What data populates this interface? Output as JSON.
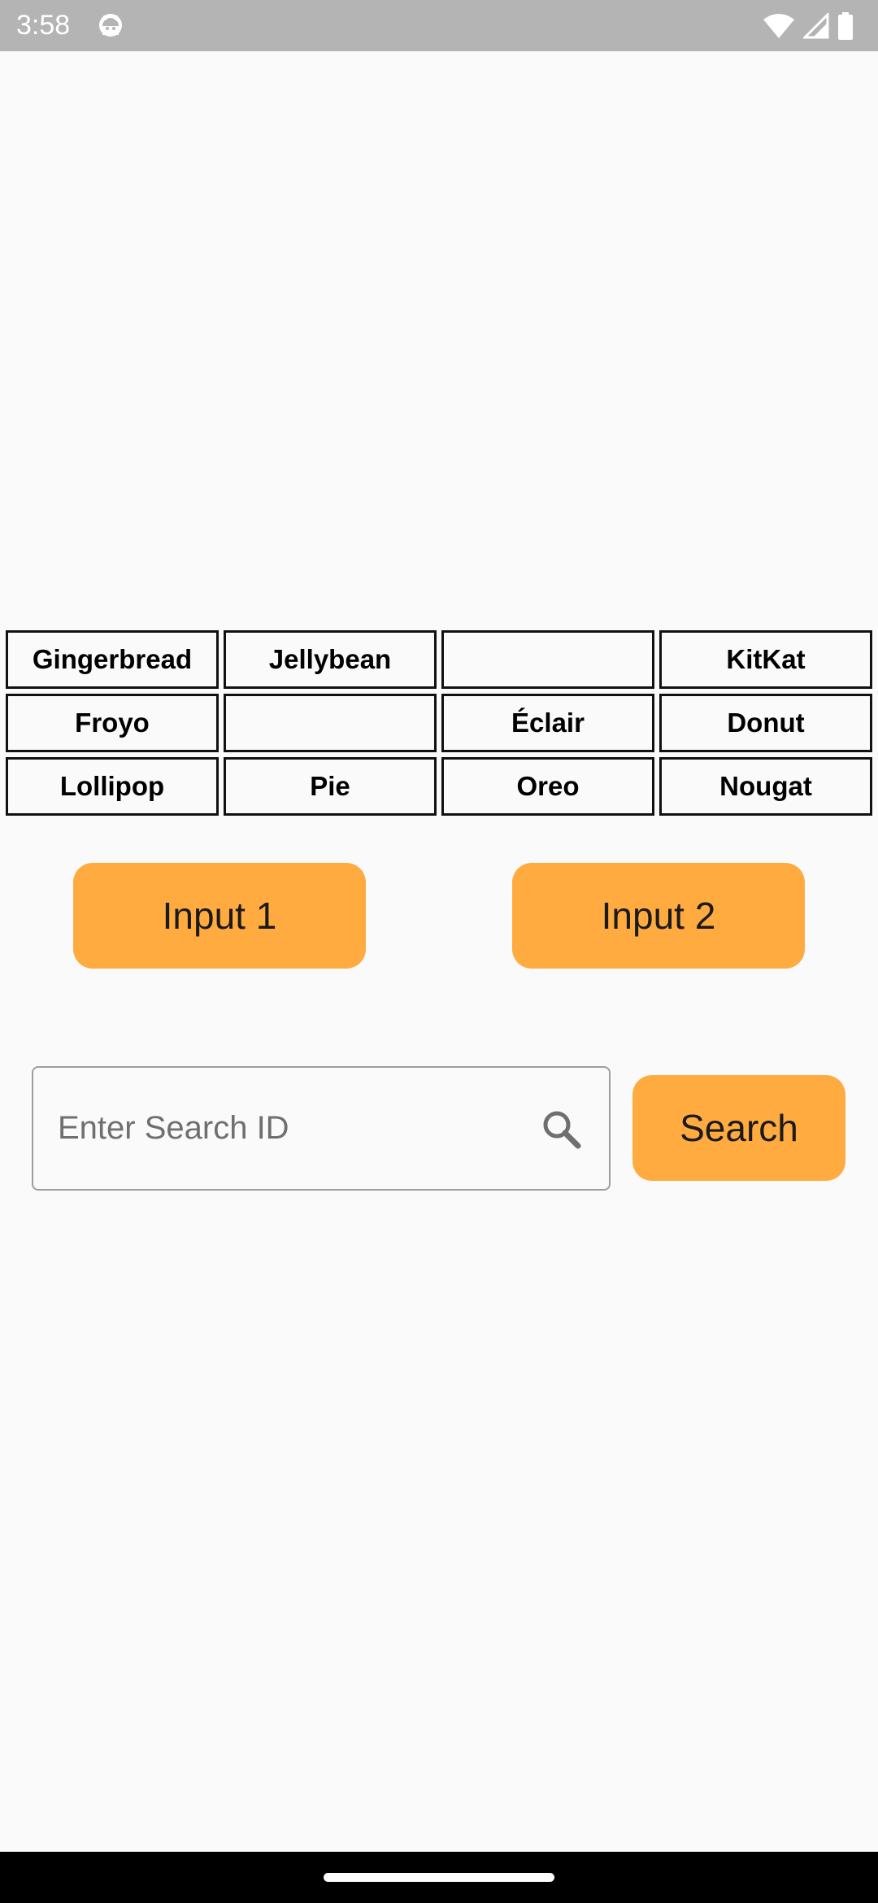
{
  "status_bar": {
    "time": "3:58",
    "app_icon": "android-robot-icon",
    "icons": [
      "wifi-icon",
      "cellular-signal-icon",
      "battery-icon"
    ]
  },
  "grid": {
    "cells": [
      "Gingerbread",
      "Jellybean",
      "",
      "KitKat",
      "Froyo",
      "",
      "Éclair",
      "Donut",
      "Lollipop",
      "Pie",
      "Oreo",
      "Nougat"
    ]
  },
  "buttons": {
    "input1_label": "Input 1",
    "input2_label": "Input 2",
    "search_label": "Search"
  },
  "search": {
    "placeholder": "Enter Search ID",
    "value": "",
    "icon": "search-icon"
  },
  "colors": {
    "accent": "#ffab40",
    "status_bar": "#b4b4b4",
    "background": "#fafafa",
    "nav_bar": "#000000"
  }
}
